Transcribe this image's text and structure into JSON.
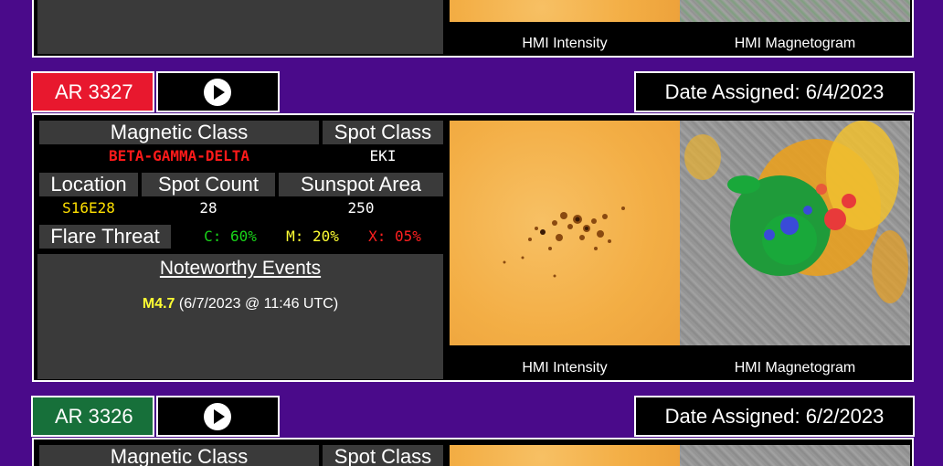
{
  "top_card": {
    "captions": {
      "intensity": "HMI Intensity",
      "magnetogram": "HMI Magnetogram"
    }
  },
  "region_3327": {
    "ar_label": "AR 3327",
    "date_assigned": "Date Assigned: 6/4/2023",
    "headers": {
      "magnetic_class": "Magnetic Class",
      "spot_class": "Spot Class",
      "location": "Location",
      "spot_count": "Spot Count",
      "sunspot_area": "Sunspot Area",
      "flare_threat": "Flare Threat"
    },
    "values": {
      "magnetic_class": "BETA-GAMMA-DELTA",
      "spot_class": "EKI",
      "location": "S16E28",
      "spot_count": "28",
      "sunspot_area": "250",
      "flare_c": "C: 60%",
      "flare_m": "M: 20%",
      "flare_x": "X: 05%"
    },
    "noteworthy": {
      "title": "Noteworthy Events",
      "event_class": "M4.7",
      "event_time": "(6/7/2023 @ 11:46 UTC)"
    },
    "captions": {
      "intensity": "HMI Intensity",
      "magnetogram": "HMI Magnetogram"
    }
  },
  "region_3326": {
    "ar_label": "AR 3326",
    "date_assigned": "Date Assigned: 6/2/2023",
    "headers": {
      "magnetic_class": "Magnetic Class",
      "spot_class": "Spot Class"
    }
  },
  "colors": {
    "background": "#4a0a8a",
    "tab_red": "#e8182e",
    "tab_green": "#17703a",
    "magnetic_class_text": "#ff1a1a",
    "location_text": "#ffe000",
    "flare_c": "#19d419",
    "flare_m": "#ffff33",
    "flare_x": "#ff2020",
    "event_class": "#ffff33"
  },
  "icons": {
    "play": "play-circle-icon"
  }
}
